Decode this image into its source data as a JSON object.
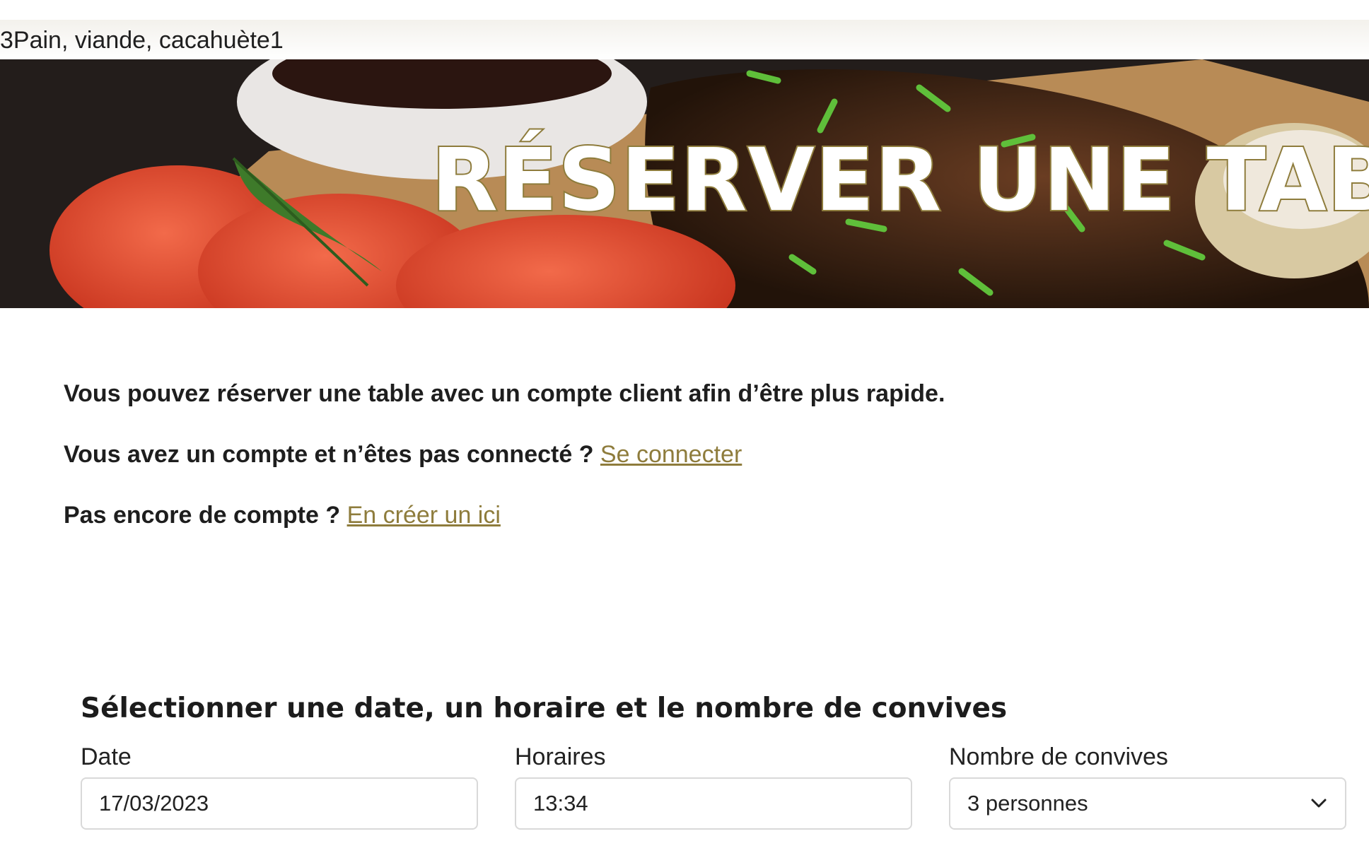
{
  "topbar": {
    "text": "3Pain, viande, cacahuète1"
  },
  "hero": {
    "title": "RÉSERVER UNE TABL"
  },
  "intro": {
    "line1": "Vous pouvez réserver une table avec un compte client afin d’être plus rapide.",
    "line2_text": "Vous avez un compte et n’êtes pas connecté ? ",
    "line2_link": "Se connecter",
    "line3_text": "Pas encore de compte ? ",
    "line3_link": "En créer un ici"
  },
  "form": {
    "heading": "Sélectionner une date, un horaire et le nombre de convives",
    "date_label": "Date",
    "date_value": "17/03/2023",
    "time_label": "Horaires",
    "time_value": "13:34",
    "guests_label": "Nombre de convives",
    "guests_value": "3 personnes"
  },
  "colors": {
    "accent": "#8e7c3c",
    "text": "#1e1e1e"
  }
}
